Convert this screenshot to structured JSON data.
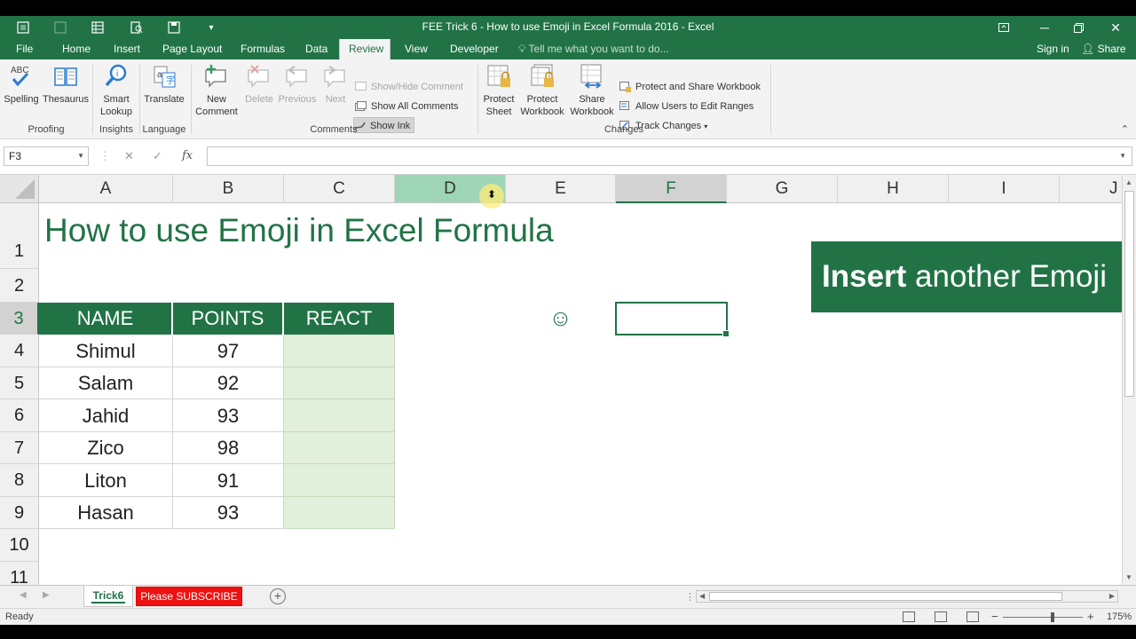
{
  "window": {
    "title": "FEE Trick 6 - How to use Emoji in Excel Formula 2016 - Excel"
  },
  "tabs": [
    {
      "label": "File"
    },
    {
      "label": "Home"
    },
    {
      "label": "Insert"
    },
    {
      "label": "Page Layout"
    },
    {
      "label": "Formulas"
    },
    {
      "label": "Data"
    },
    {
      "label": "Review"
    },
    {
      "label": "View"
    },
    {
      "label": "Developer"
    }
  ],
  "active_tab": "Review",
  "tell_me": "Tell me what you want to do...",
  "account": {
    "sign_in": "Sign in",
    "share": "Share"
  },
  "ribbon": {
    "proofing": {
      "label": "Proofing",
      "spelling": "Spelling",
      "thesaurus": "Thesaurus",
      "abc": "ABC"
    },
    "insights": {
      "label": "Insights",
      "smart_lookup_1": "Smart",
      "smart_lookup_2": "Lookup"
    },
    "language": {
      "label": "Language",
      "translate": "Translate"
    },
    "comments": {
      "label": "Comments",
      "new_comment_1": "New",
      "new_comment_2": "Comment",
      "delete": "Delete",
      "previous": "Previous",
      "next": "Next",
      "show_hide": "Show/Hide Comment",
      "show_all": "Show All Comments",
      "show_ink": "Show Ink"
    },
    "changes": {
      "label": "Changes",
      "protect_sheet_1": "Protect",
      "protect_sheet_2": "Sheet",
      "protect_workbook_1": "Protect",
      "protect_workbook_2": "Workbook",
      "share_workbook_1": "Share",
      "share_workbook_2": "Workbook",
      "protect_share": "Protect and Share Workbook",
      "allow_users": "Allow Users to Edit Ranges",
      "track_changes": "Track Changes"
    }
  },
  "formula_bar": {
    "name_box": "F3",
    "value": ""
  },
  "columns": [
    "A",
    "B",
    "C",
    "D",
    "E",
    "F",
    "G",
    "H",
    "I",
    "J"
  ],
  "rows": [
    "1",
    "2",
    "3",
    "4",
    "5",
    "6",
    "7",
    "8",
    "9",
    "10",
    "11"
  ],
  "sheet": {
    "title": "How to use Emoji in Excel Formula",
    "headers": [
      "NAME",
      "POINTS",
      "REACT"
    ],
    "records": [
      {
        "name": "Shimul",
        "points": "97"
      },
      {
        "name": "Salam",
        "points": "92"
      },
      {
        "name": "Jahid",
        "points": "93"
      },
      {
        "name": "Zico",
        "points": "98"
      },
      {
        "name": "Liton",
        "points": "91"
      },
      {
        "name": "Hasan",
        "points": "93"
      }
    ],
    "emoji": "☺"
  },
  "banner": {
    "bold": "Insert",
    "rest": " another Emoji"
  },
  "sheet_tabs": {
    "active": "Trick6",
    "other": "Please SUBSCRIBE"
  },
  "status": {
    "text": "Ready",
    "zoom": "175%"
  },
  "colors": {
    "accent": "#217346",
    "react_fill": "#e2efda",
    "subscribe": "#ee1111"
  }
}
